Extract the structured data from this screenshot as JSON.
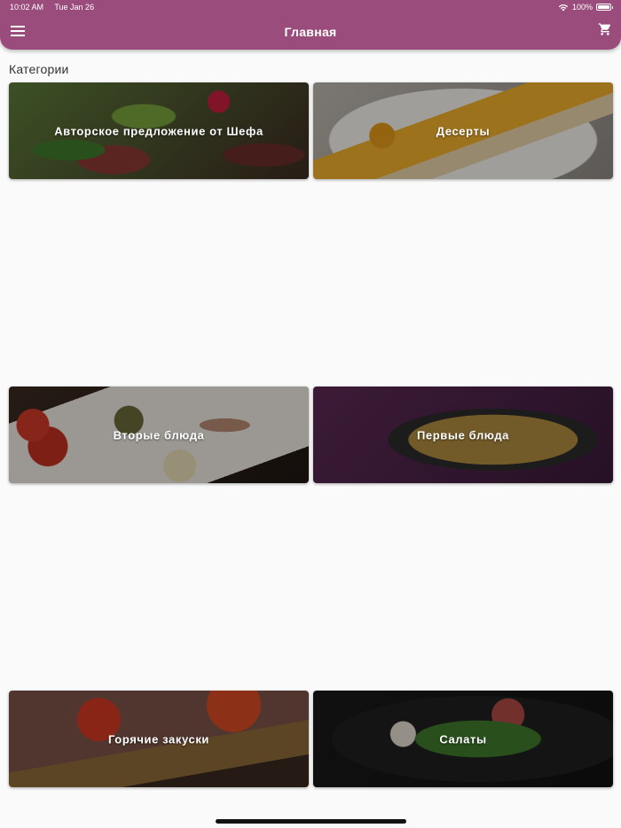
{
  "status_bar": {
    "time": "10:02 AM",
    "date": "Tue Jan 26",
    "battery": "100%",
    "icons": [
      "wifi-icon",
      "battery-icon"
    ]
  },
  "app_bar": {
    "title": "Главная",
    "menu_icon": "hamburger-menu-icon",
    "cart_icon": "shopping-cart-icon"
  },
  "section": {
    "label": "Категории"
  },
  "categories": [
    {
      "label": "Авторское предложение от Шефа"
    },
    {
      "label": "Десерты"
    },
    {
      "label": "Вторые блюда"
    },
    {
      "label": "Первые блюда"
    },
    {
      "label": "Горячие закуски"
    },
    {
      "label": "Салаты"
    }
  ],
  "colors": {
    "app_bar": "#9a4d7c",
    "background": "#fafafa"
  }
}
